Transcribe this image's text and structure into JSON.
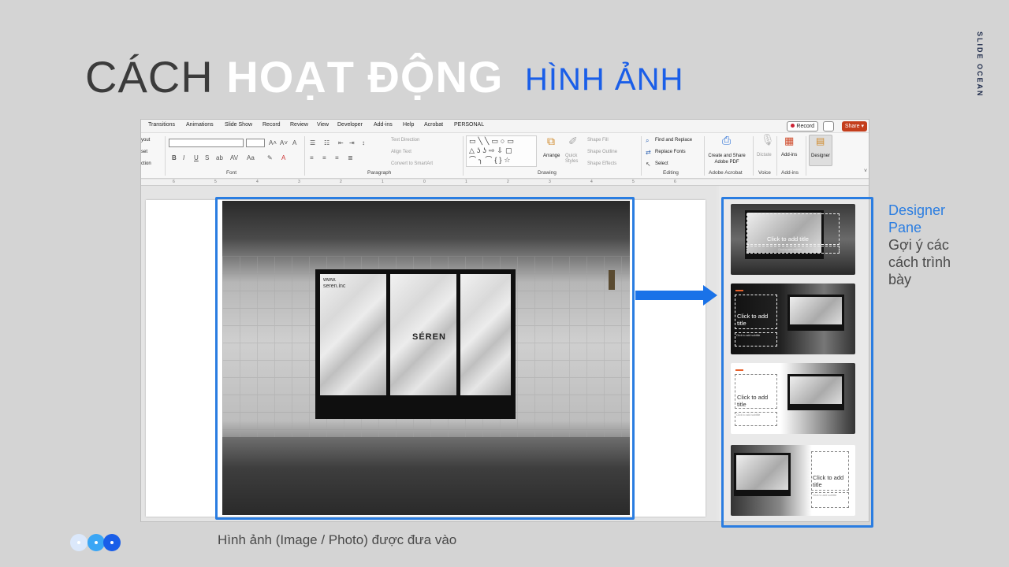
{
  "header": {
    "title_thin": "CÁCH",
    "title_bold": "HOẠT ĐỘNG",
    "subtitle": "HÌNH ẢNH",
    "brand": "SLIDE OCEAN"
  },
  "ppt": {
    "menu_tabs": [
      "Transitions",
      "Animations",
      "Slide Show",
      "Record",
      "Review",
      "View",
      "Developer",
      "Add-ins",
      "Help",
      "Acrobat",
      "PERSONAL"
    ],
    "record_label": "Record",
    "share_label": "Share",
    "ribbon": {
      "left_items": [
        "yout",
        "set",
        "ction"
      ],
      "font_group": "Font",
      "paragraph_group": "Paragraph",
      "text_direction": "Text Direction",
      "align_text": "Align Text",
      "convert_smartart": "Convert to SmartArt",
      "drawing_group": "Drawing",
      "arrange": "Arrange",
      "quick_styles": "Quick Styles",
      "shape_fill": "Shape Fill",
      "shape_outline": "Shape Outline",
      "shape_effects": "Shape Effects",
      "find_replace": "Find and Replace",
      "replace_fonts": "Replace Fonts",
      "select": "Select",
      "editing_group": "Editing",
      "create_share_pdf": "Create and Share Adobe PDF",
      "adobe_acrobat_group": "Adobe Acrobat",
      "dictate": "Dictate",
      "voice_group": "Voice",
      "addins": "Add-ins",
      "addins_group": "Add-ins",
      "designer": "Designer"
    },
    "ruler_numbers": [
      "6",
      "5",
      "4",
      "3",
      "2",
      "1",
      "0",
      "1",
      "2",
      "3",
      "4",
      "5",
      "6"
    ],
    "billboard": {
      "url": "www.\nseren.inc",
      "logo": "SÉREN"
    }
  },
  "designer_pane": {
    "thumbnails": [
      {
        "title": "Click to add title",
        "subtitle": "Click to add subtitle"
      },
      {
        "title": "Click to add\ntitle",
        "subtitle": "Click to add subtitle"
      },
      {
        "title": "Click to add\ntitle",
        "subtitle": "Click to add subtitle"
      },
      {
        "title": "Click to add\ntitle",
        "subtitle": "Click to add subtitle"
      }
    ]
  },
  "annotations": {
    "pane_title": "Designer\nPane",
    "pane_desc": "Gợi ý các cách trình bày",
    "caption": "Hình ảnh (Image / Photo) được đưa vào"
  },
  "colors": {
    "accent_blue": "#2a7de1",
    "title_dark": "#3b3b3b",
    "share_orange": "#c43e1c"
  }
}
